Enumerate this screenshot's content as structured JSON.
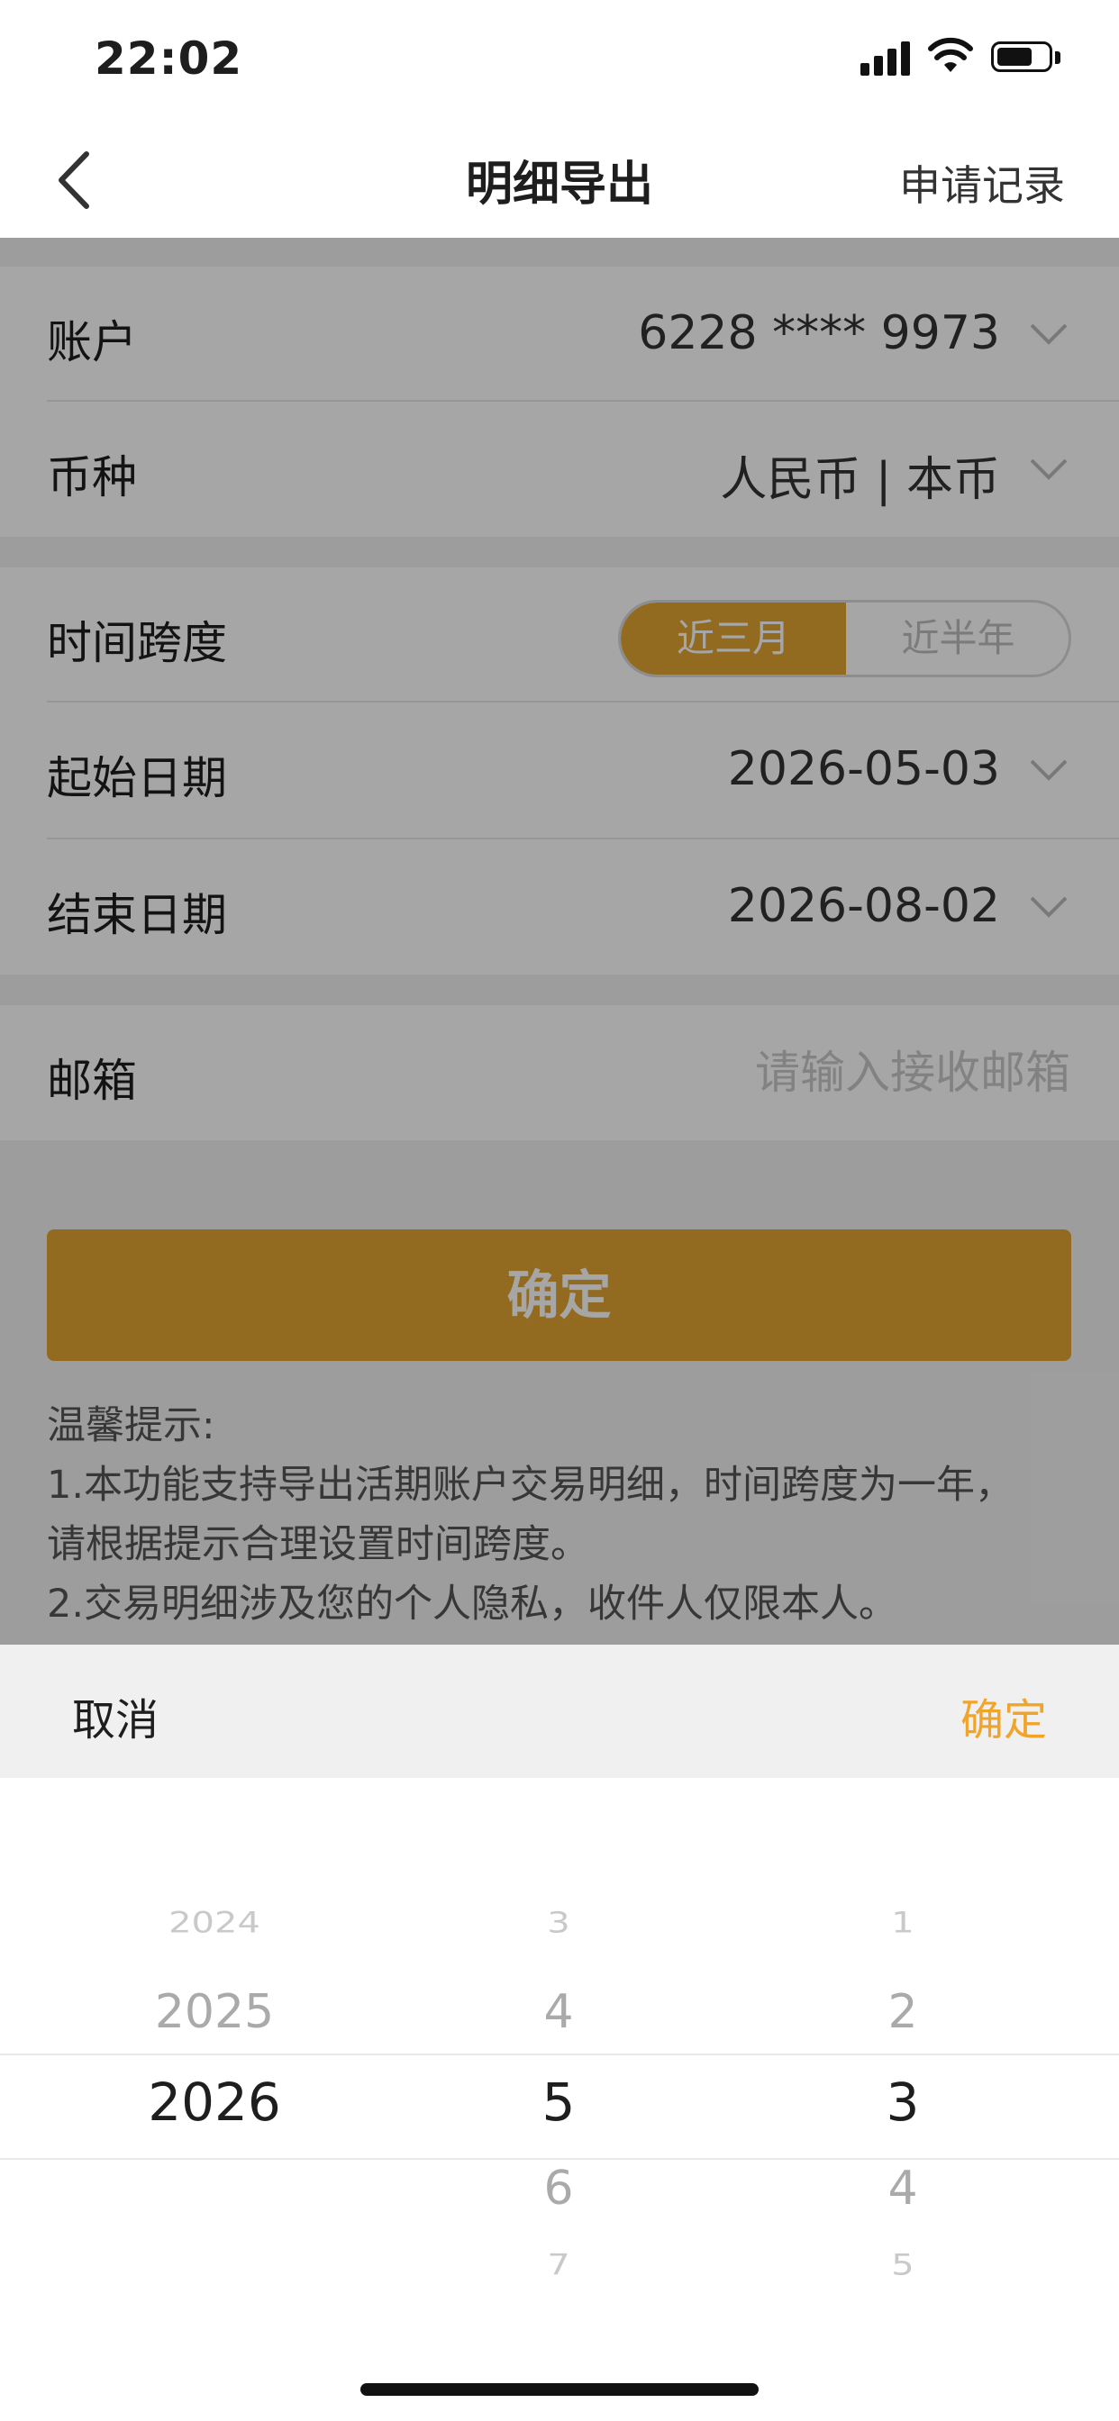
{
  "status_bar": {
    "time": "22:02"
  },
  "nav": {
    "title": "明细导出",
    "right_link": "申请记录",
    "back_icon": "chevron-left-icon"
  },
  "form": {
    "account": {
      "label": "账户",
      "value": "6228 **** 9973"
    },
    "currency": {
      "label": "币种",
      "value": "人民币 | 本币"
    },
    "time_span": {
      "label": "时间跨度",
      "options": [
        "近三月",
        "近半年"
      ],
      "selected": "近三月"
    },
    "start_date": {
      "label": "起始日期",
      "value": "2026-05-03"
    },
    "end_date": {
      "label": "结束日期",
      "value": "2026-08-02"
    },
    "email": {
      "label": "邮箱",
      "placeholder": "请输入接收邮箱"
    }
  },
  "confirm_button": "确定",
  "tips": {
    "title": "温馨提示:",
    "lines": [
      "1.本功能支持导出活期账户交易明细，时间跨度为一年，",
      "请根据提示合理设置时间跨度。",
      "2.交易明细涉及您的个人隐私，收件人仅限本人。"
    ]
  },
  "picker": {
    "cancel": "取消",
    "ok": "确定",
    "years": [
      "2024",
      "2025",
      "2026"
    ],
    "months": [
      "3",
      "4",
      "5",
      "6",
      "7"
    ],
    "days": [
      "1",
      "2",
      "3",
      "4",
      "5"
    ],
    "selected": {
      "year": "2026",
      "month": "5",
      "day": "3"
    }
  },
  "colors": {
    "accent": "#e0a534",
    "picker_ok": "#f0a52a"
  }
}
